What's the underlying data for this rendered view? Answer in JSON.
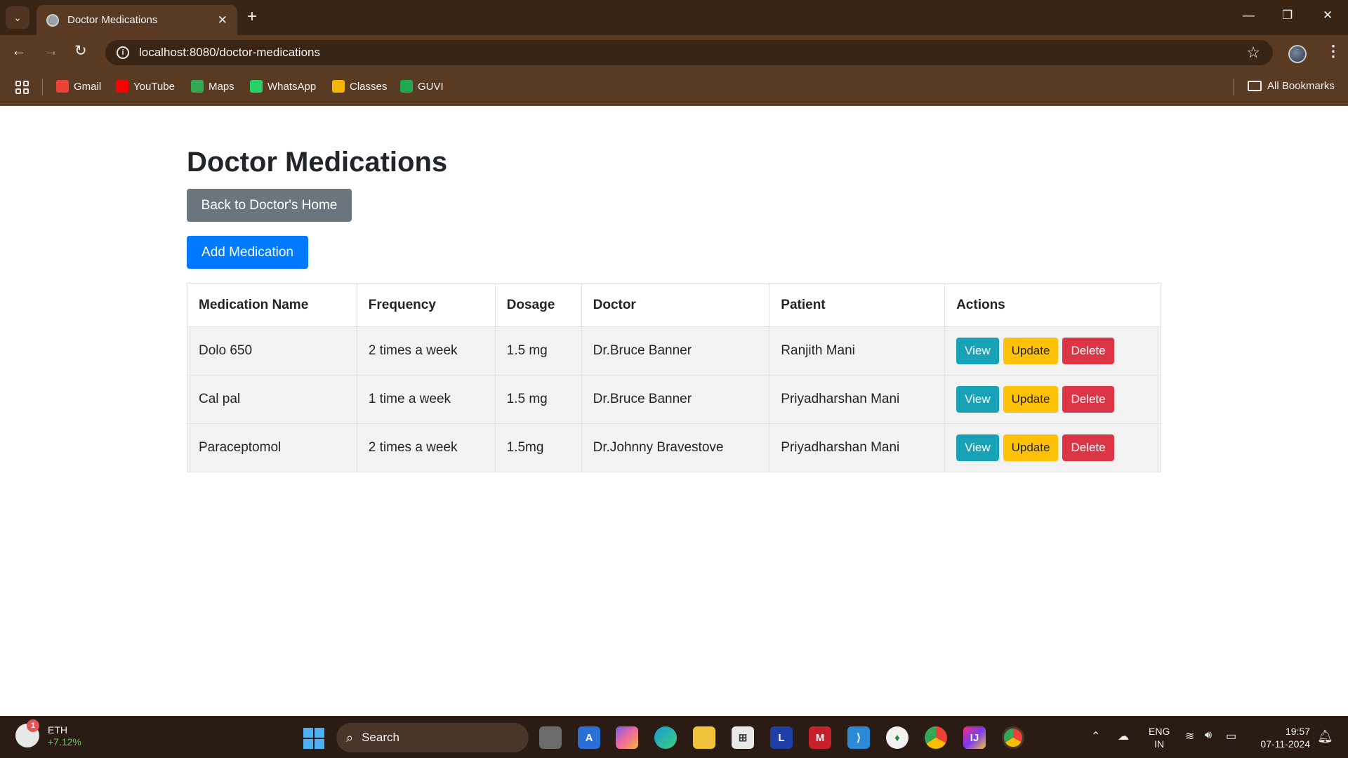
{
  "browser": {
    "tab_title": "Doctor Medications",
    "url": "localhost:8080/doctor-medications",
    "bookmarks": [
      {
        "label": "Gmail",
        "icon": "gmail-icon",
        "color": "#ea4335"
      },
      {
        "label": "YouTube",
        "icon": "youtube-icon",
        "color": "#ff0000"
      },
      {
        "label": "Maps",
        "icon": "maps-icon",
        "color": "#34a853"
      },
      {
        "label": "WhatsApp",
        "icon": "whatsapp-icon",
        "color": "#25d366"
      },
      {
        "label": "Classes",
        "icon": "classroom-icon",
        "color": "#f4b400"
      },
      {
        "label": "GUVI",
        "icon": "guvi-icon",
        "color": "#1fa84f"
      }
    ],
    "all_bookmarks_label": "All Bookmarks"
  },
  "page": {
    "title": "Doctor Medications",
    "back_button": "Back to Doctor's Home",
    "add_button": "Add Medication"
  },
  "table": {
    "headers": [
      "Medication Name",
      "Frequency",
      "Dosage",
      "Doctor",
      "Patient",
      "Actions"
    ],
    "rows": [
      {
        "name": "Dolo 650",
        "frequency": "2 times a week",
        "dosage": "1.5 mg",
        "doctor": "Dr.Bruce Banner",
        "patient": "Ranjith Mani"
      },
      {
        "name": "Cal pal",
        "frequency": "1 time a week",
        "dosage": "1.5 mg",
        "doctor": "Dr.Bruce Banner",
        "patient": "Priyadharshan Mani"
      },
      {
        "name": "Paraceptomol",
        "frequency": "2 times a week",
        "dosage": "1.5mg",
        "doctor": "Dr.Johnny Bravestove",
        "patient": "Priyadharshan Mani"
      }
    ],
    "actions": {
      "view": "View",
      "update": "Update",
      "delete": "Delete"
    }
  },
  "taskbar": {
    "ticker": {
      "symbol": "ETH",
      "change": "+7.12%",
      "badge": "1"
    },
    "search_label": "Search",
    "lang_line1": "ENG",
    "lang_line2": "IN",
    "time": "19:57",
    "date": "07-11-2024"
  },
  "colors": {
    "primary": "#007bff",
    "secondary": "#6c757d",
    "info": "#17a2b8",
    "warning": "#ffc107",
    "danger": "#dc3545"
  }
}
